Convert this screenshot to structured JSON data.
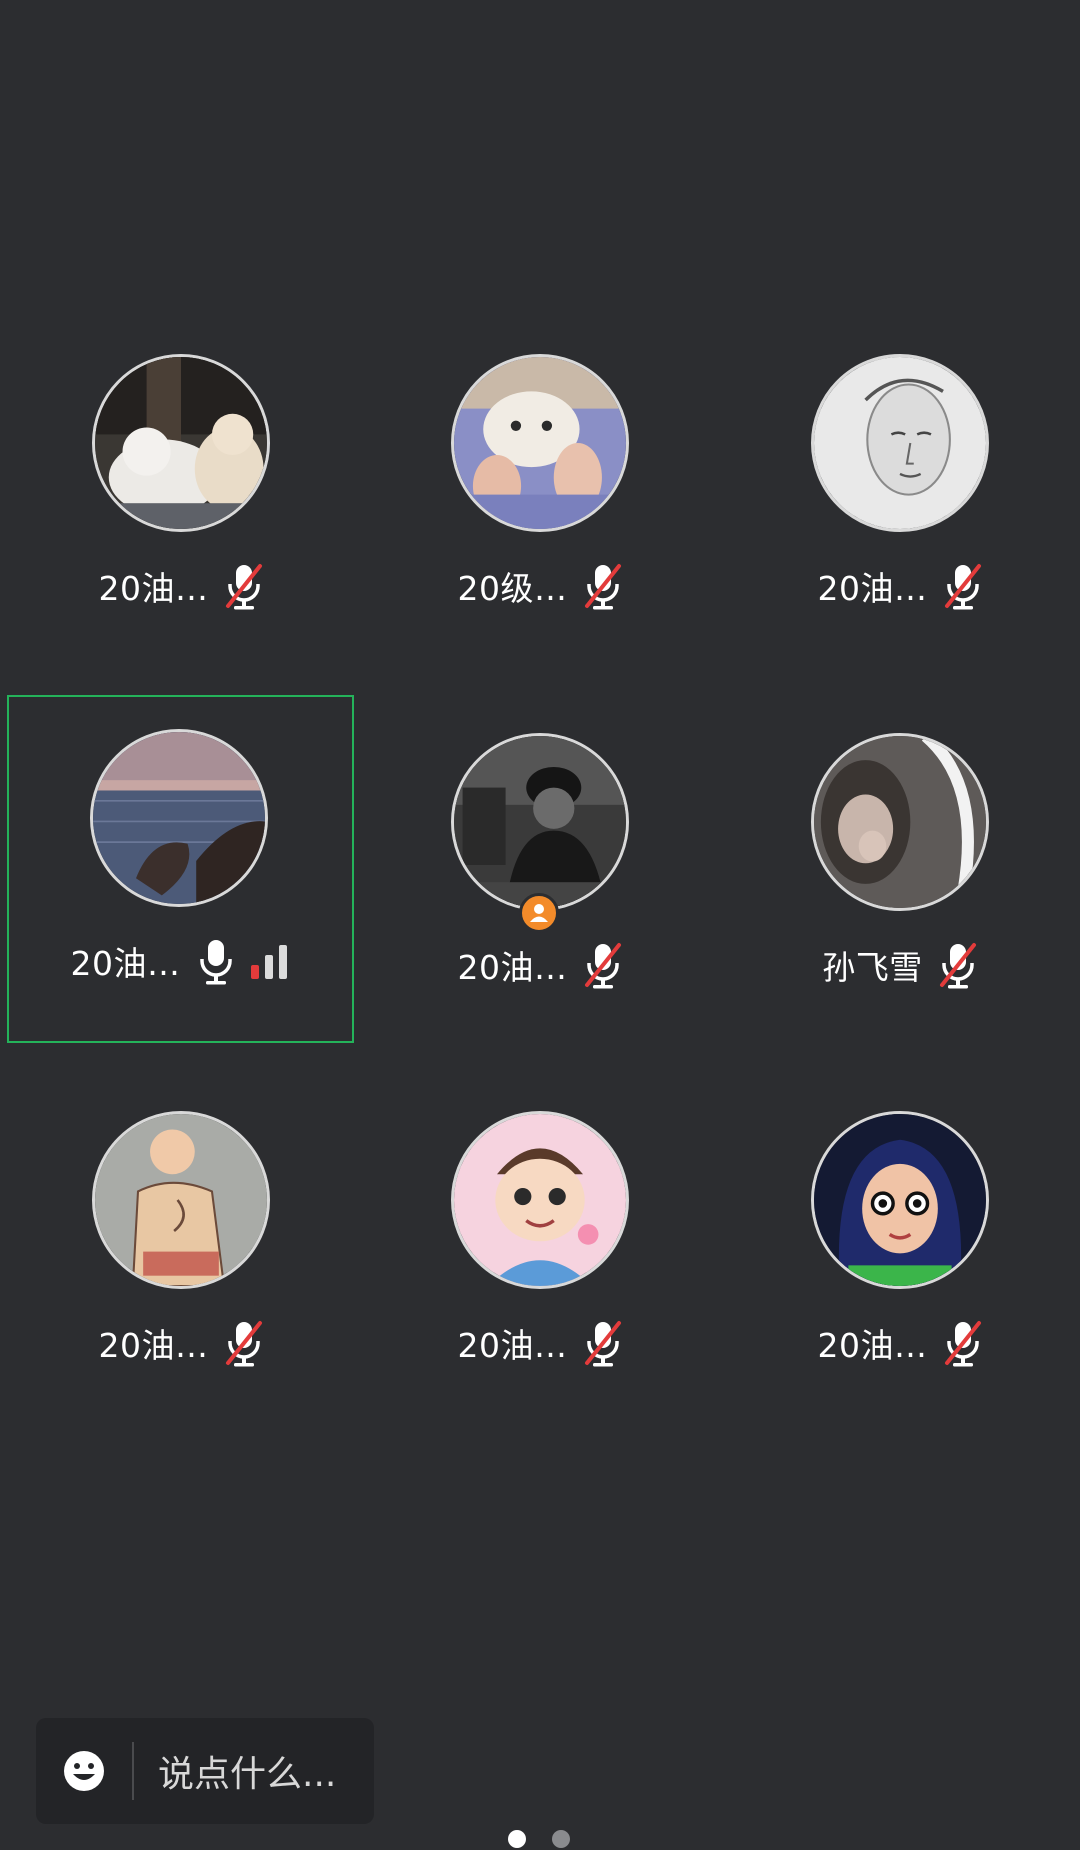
{
  "participants": [
    {
      "name": "20油…",
      "mic": "muted",
      "avatar": "cats-photo"
    },
    {
      "name": "20级…",
      "mic": "muted",
      "avatar": "cat-held-photo"
    },
    {
      "name": "20油…",
      "mic": "muted",
      "avatar": "sketch-portrait"
    },
    {
      "name": "20油…",
      "mic": "on",
      "avatar": "sea-rocks-photo",
      "active": true
    },
    {
      "name": "20油…",
      "mic": "muted",
      "avatar": "person-in-cap-photo",
      "host": true
    },
    {
      "name": "孙飞雪",
      "mic": "muted",
      "avatar": "girl-selfie-photo"
    },
    {
      "name": "20油…",
      "mic": "muted",
      "avatar": "cartoon-boy-illustration"
    },
    {
      "name": "20油…",
      "mic": "muted",
      "avatar": "cartoon-kid-flower"
    },
    {
      "name": "20油…",
      "mic": "muted",
      "avatar": "anime-girl-illustration"
    }
  ],
  "chat": {
    "placeholder": "说点什么..."
  },
  "colors": {
    "background": "#2c2d30",
    "active_border": "#24b35a",
    "muted_slash": "#e33b3b",
    "host_badge": "#f38b2a"
  }
}
